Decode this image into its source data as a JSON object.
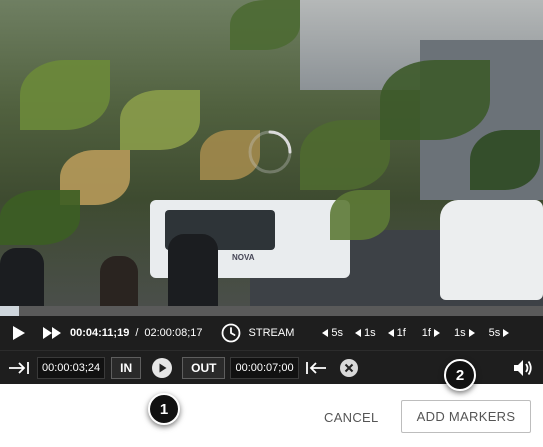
{
  "video": {
    "bus_text": "NOVA",
    "progress": 0.035,
    "loading": true
  },
  "playback": {
    "current_time": "00:04:11;19",
    "separator": "/",
    "duration": "02:00:08;17",
    "stream_label": "STREAM",
    "steps": {
      "back_5s": "5s",
      "back_1s": "1s",
      "back_1f": "1f",
      "fwd_1f": "1f",
      "fwd_1s": "1s",
      "fwd_5s": "5s"
    }
  },
  "markers": {
    "in_time": "00:00:03;24",
    "in_label": "IN",
    "out_label": "OUT",
    "out_time": "00:00:07;00"
  },
  "callouts": {
    "one": "1",
    "two": "2"
  },
  "dialog": {
    "cancel_label": "CANCEL",
    "add_markers_label": "ADD MARKERS"
  },
  "colors": {
    "player_bg": "#1e1e1e",
    "progress_fill": "#cfd6dc",
    "button_text": "#555555"
  },
  "icons": [
    "play-icon",
    "fast-forward-icon",
    "clock-icon",
    "go-to-in-icon",
    "play-circle-icon",
    "go-to-out-icon",
    "clear-icon",
    "volume-icon",
    "loading-spinner-icon"
  ]
}
